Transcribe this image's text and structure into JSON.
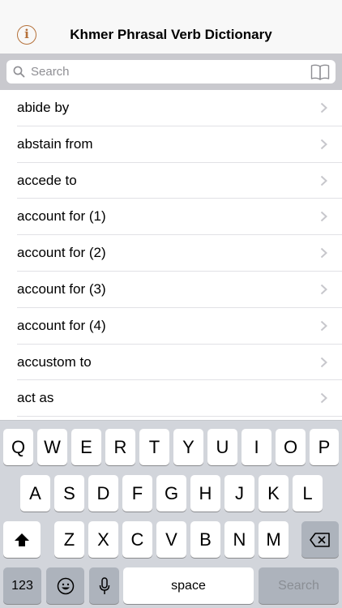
{
  "navbar": {
    "info_glyph": "i",
    "title": "Khmer Phrasal Verb Dictionary"
  },
  "search": {
    "placeholder": "Search"
  },
  "list": {
    "items": [
      {
        "label": "abide by"
      },
      {
        "label": "abstain from"
      },
      {
        "label": "accede to"
      },
      {
        "label": "account for (1)"
      },
      {
        "label": "account for (2)"
      },
      {
        "label": "account for (3)"
      },
      {
        "label": "account for (4)"
      },
      {
        "label": "accustom to"
      },
      {
        "label": "act as"
      }
    ]
  },
  "keyboard": {
    "row1": [
      "Q",
      "W",
      "E",
      "R",
      "T",
      "Y",
      "U",
      "I",
      "O",
      "P"
    ],
    "row2": [
      "A",
      "S",
      "D",
      "F",
      "G",
      "H",
      "J",
      "K",
      "L"
    ],
    "row3": [
      "Z",
      "X",
      "C",
      "V",
      "B",
      "N",
      "M"
    ],
    "numbers_label": "123",
    "space_label": "space",
    "search_label": "Search"
  },
  "colors": {
    "accent": "#b5713a",
    "keyboard_bg": "#d2d5db",
    "search_bar_bg": "#c9c9ce"
  }
}
